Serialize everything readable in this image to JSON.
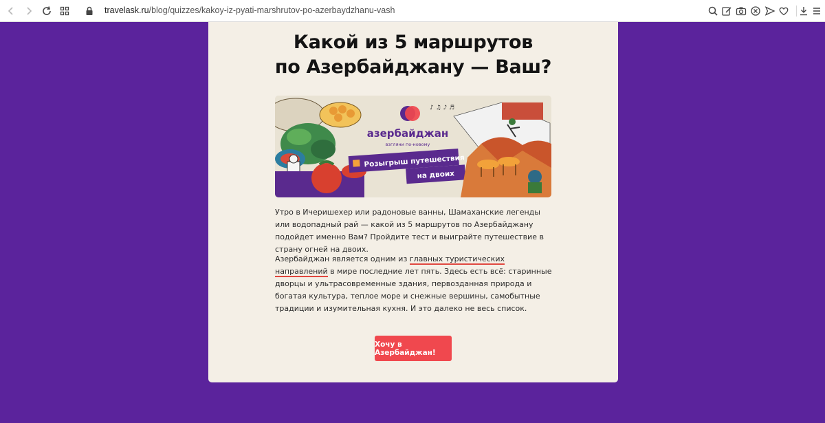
{
  "browser": {
    "url_host": "travelask.ru",
    "url_path": "/blog/quizzes/kakoy-iz-pyati-marshrutov-po-azerbaydzhanu-vash"
  },
  "article": {
    "title_line1": "Какой из 5 маршрутов",
    "title_line2": "по Азербайджану — Ваш?",
    "banner": {
      "brand": "азербайджан",
      "tagline": "взгляни по-новому",
      "promo_line1": "Розыгрыш путешествия",
      "promo_line2": "на двоих"
    },
    "para1": "Утро в Ичеришехер или радоновые ванны, Шамаханские легенды или водопадный рай — какой из 5 маршрутов по Азербайджану подойдет именно Вам? Пройдите тест и выиграйте путешествие в страну огней на двоих.",
    "para2_before": "Азербайджан является одним из ",
    "para2_link": "главных туристических направлений",
    "para2_after": " в мире последние лет пять. Здесь есть всё: старинные дворцы и ультрасовременные здания, первозданная природа и богатая культура, теплое море и снежные вершины, самобытные традиции и изумительная кухня. И это далеко не весь список.",
    "cta_label": "Хочу в Азербайджан!"
  },
  "colors": {
    "page_bg": "#5b239c",
    "card_bg": "#f4efe6",
    "cta_bg": "#f0484e",
    "link_underline": "#e0473f"
  }
}
